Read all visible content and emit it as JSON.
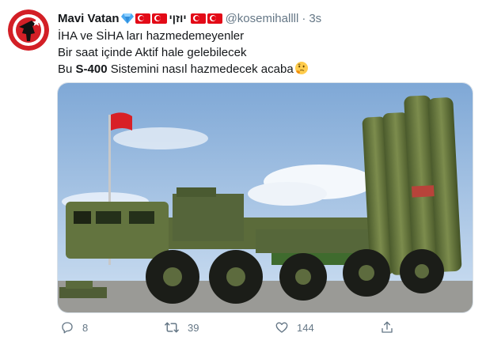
{
  "tweet": {
    "display_name": "Mavi Vatan",
    "name_suffix_text": "יוזןי",
    "handle": "@kosemihallll",
    "separator": "·",
    "time": "3s",
    "lines": [
      "İHA ve SİHA ları hazmedemeyenler",
      "Bir saat içinde Aktif hale gelebilecek"
    ],
    "line3": {
      "prefix": "Bu ",
      "bold": "S-400",
      "rest": "  Sistemini nasıl hazmedecek acaba"
    },
    "emoji": "thinking-face-icon",
    "media_alt": "S-400 missile launcher vehicle",
    "actions": {
      "reply_count": "8",
      "retweet_count": "39",
      "like_count": "144"
    }
  },
  "colors": {
    "flag_red": "#e30a17",
    "meta_gray": "#657786",
    "text": "#14171a",
    "truck_green": "#5b6b3a",
    "sky": "#a9c6e6"
  }
}
